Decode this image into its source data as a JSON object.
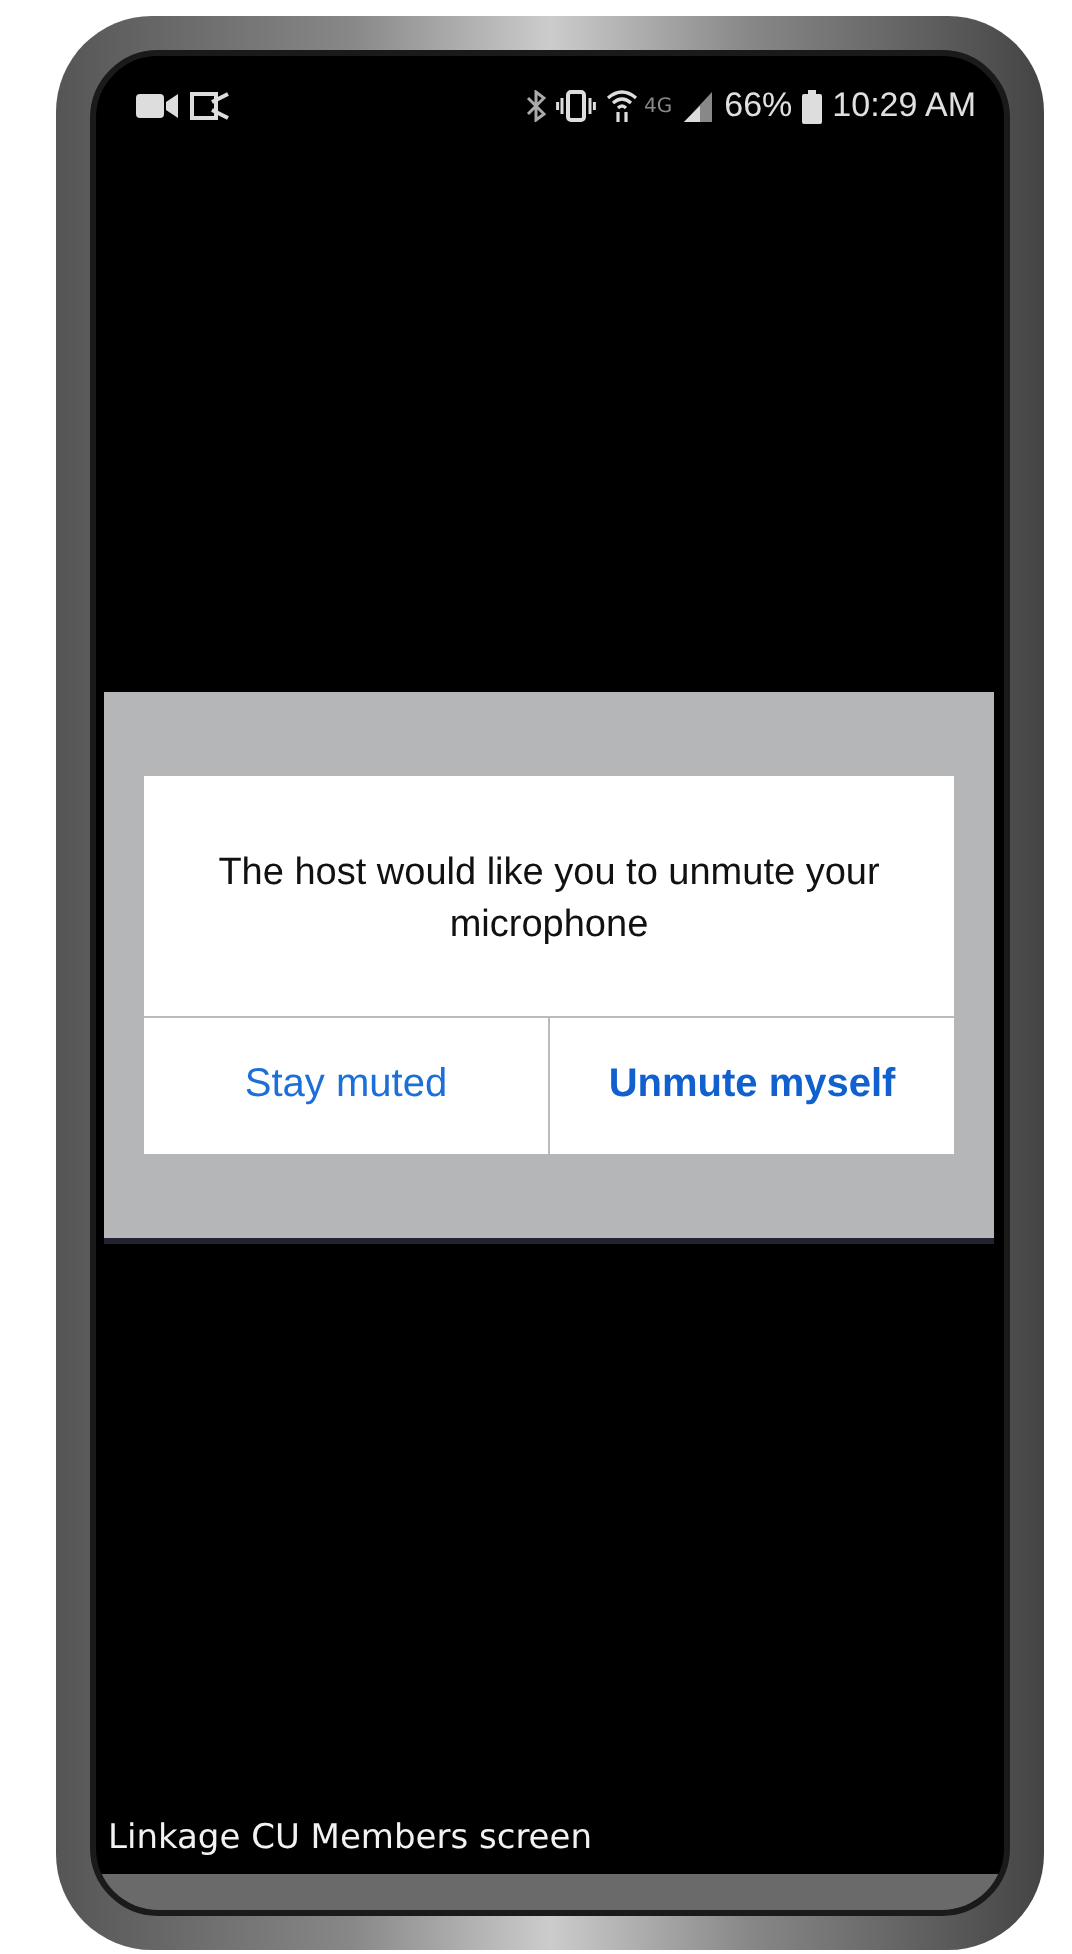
{
  "status_bar": {
    "network": "4G",
    "battery": "66%",
    "time": "10:29 AM"
  },
  "dialog": {
    "message": "The host would like you to unmute your microphone",
    "buttons": [
      {
        "label": "Stay muted",
        "primary": false
      },
      {
        "label": "Unmute myself",
        "primary": true
      }
    ]
  },
  "caption": "Linkage CU Members screen"
}
